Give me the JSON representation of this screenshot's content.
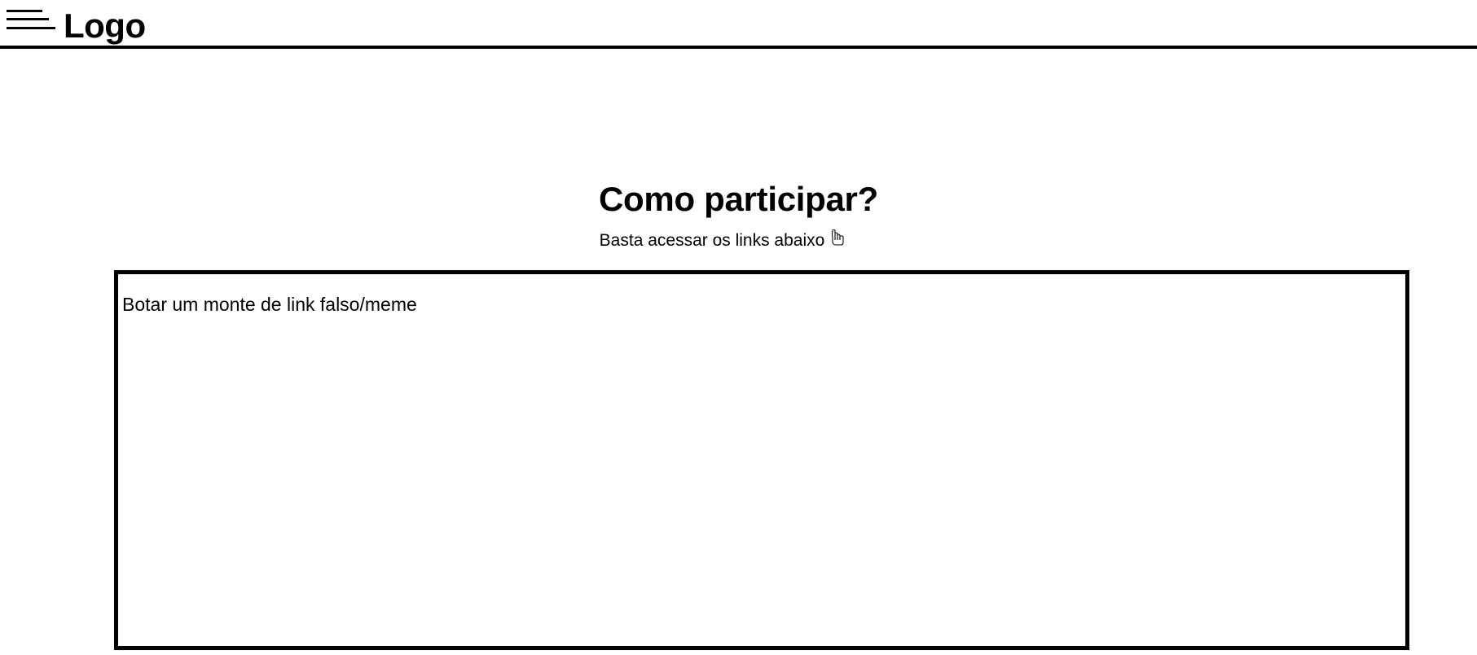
{
  "header": {
    "logo_text": "Logo",
    "menu_icon": "hamburger-menu-icon"
  },
  "main": {
    "title": "Como participar?",
    "subtitle": "Basta acessar os links abaixo",
    "subtitle_icon": "pointing-down-hand-icon",
    "links_box": {
      "text": "Botar um monte de link falso/meme"
    }
  },
  "colors": {
    "background": "#ffffff",
    "foreground": "#000000"
  }
}
